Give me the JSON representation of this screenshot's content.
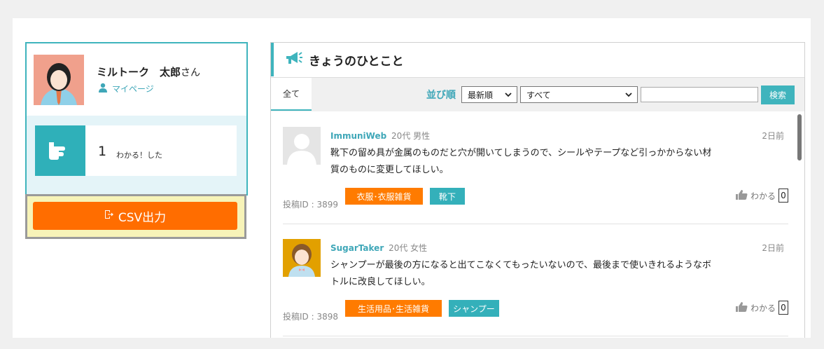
{
  "profile": {
    "name": "ミルトーク　太郎",
    "honorific": "さん",
    "mypage_label": "マイページ"
  },
  "stats": {
    "count": "1",
    "label": "わかる！した"
  },
  "csv": {
    "label": "CSV出力"
  },
  "panel": {
    "title": "きょうのひとこと",
    "tab_all": "全て",
    "sort_label": "並び順",
    "sort_selected": "最新順",
    "filter_selected": "すべて",
    "search_button": "検索",
    "search_placeholder": ""
  },
  "posts": [
    {
      "username": "ImmuniWeb",
      "meta": "20代 男性",
      "date": "2日前",
      "text": "靴下の留め具が金属のものだと穴が開いてしまうので、シールやテープなど引っかからない材質のものに変更してほしい。",
      "post_id": "投稿ID : 3899",
      "tags": [
        "衣服･衣服雑貨",
        "靴下"
      ],
      "like_label": "わかる",
      "like_count": "0"
    },
    {
      "username": "SugarTaker",
      "meta": "20代 女性",
      "date": "2日前",
      "text": "シャンプーが最後の方になると出てこなくてもったいないので、最後まで使いきれるようなボトルに改良してほしい。",
      "post_id": "投稿ID : 3898",
      "tags": [
        "生活用品･生活雑貨",
        "シャンプー"
      ],
      "like_label": "わかる",
      "like_count": "0"
    }
  ],
  "colors": {
    "accent": "#3fb4bd",
    "orange": "#ff6d00",
    "link": "#3fa7b8"
  }
}
